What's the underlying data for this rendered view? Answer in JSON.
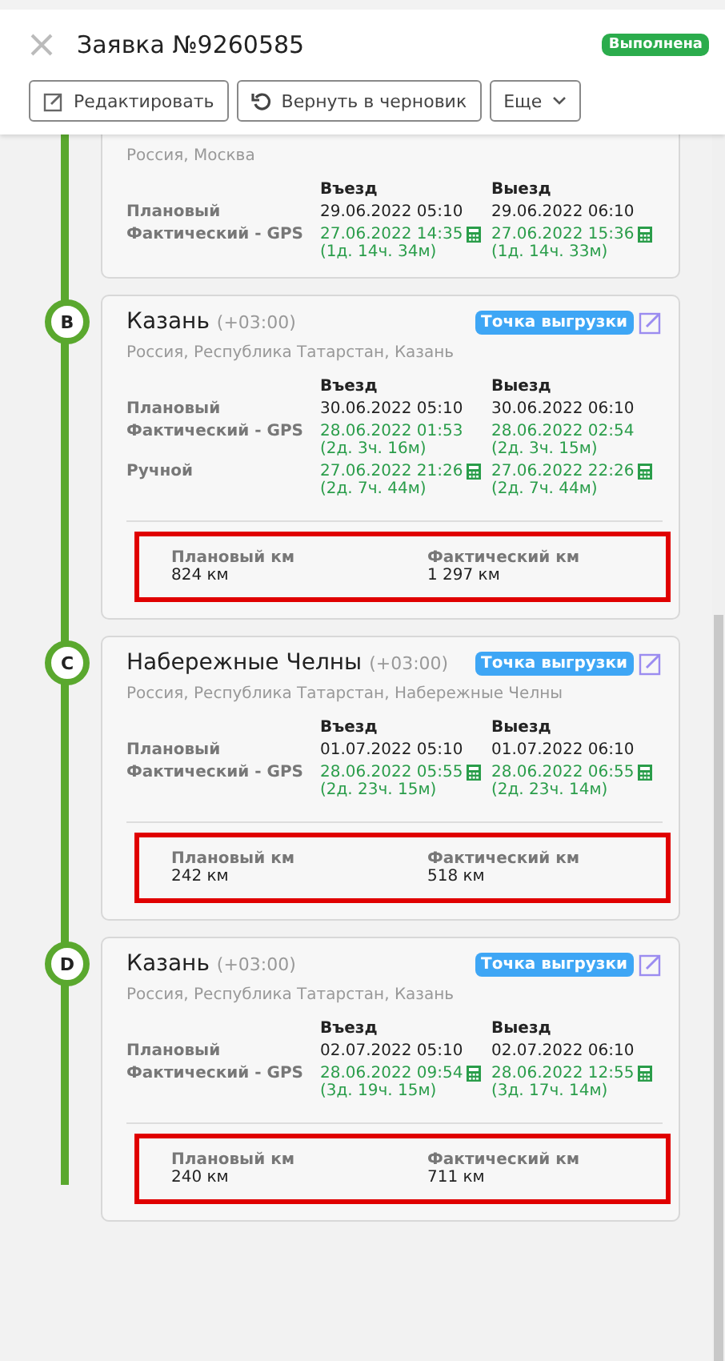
{
  "header": {
    "title": "Заявка №9260585",
    "status": "Выполнена",
    "buttons": [
      {
        "kind": "edit",
        "label": "Редактировать"
      },
      {
        "kind": "revert",
        "label": "Вернуть в черновик"
      },
      {
        "kind": "more",
        "label": "Еще"
      }
    ]
  },
  "stops": [
    {
      "address": "Россия, Москва",
      "col_in": "Въезд",
      "col_out": "Выезд",
      "rows": [
        {
          "kind": "plan",
          "label": "Плановый",
          "in": {
            "time": "29.06.2022 05:10"
          },
          "out": {
            "time": "29.06.2022 06:10"
          }
        },
        {
          "kind": "actual",
          "label": "Фактический - GPS",
          "in": {
            "time": "27.06.2022 14:35",
            "delta": "(1д. 14ч. 34м)",
            "calc": true
          },
          "out": {
            "time": "27.06.2022 15:36",
            "delta": "(1д. 14ч. 33м)",
            "calc": true
          }
        }
      ]
    },
    {
      "letter": "B",
      "city": "Казань",
      "tz": "(+03:00)",
      "badge": "Точка выгрузки",
      "address": "Россия, Республика Татарстан, Казань",
      "col_in": "Въезд",
      "col_out": "Выезд",
      "rows": [
        {
          "kind": "plan",
          "label": "Плановый",
          "in": {
            "time": "30.06.2022 05:10"
          },
          "out": {
            "time": "30.06.2022 06:10"
          }
        },
        {
          "kind": "actual",
          "label": "Фактический - GPS",
          "in": {
            "time": "28.06.2022 01:53",
            "delta": "(2д. 3ч. 16м)",
            "calc": false
          },
          "out": {
            "time": "28.06.2022 02:54",
            "delta": "(2д. 3ч. 15м)",
            "calc": false
          }
        },
        {
          "kind": "actual",
          "label": "Ручной",
          "in": {
            "time": "27.06.2022 21:26",
            "delta": "(2д. 7ч. 44м)",
            "calc": true
          },
          "out": {
            "time": "27.06.2022 22:26",
            "delta": "(2д. 7ч. 44м)",
            "calc": true
          }
        }
      ],
      "km": {
        "highlighted": true,
        "plan_label": "Плановый км",
        "plan": "824 км",
        "fact_label": "Фактический км",
        "fact": "1 297 км"
      }
    },
    {
      "letter": "C",
      "city": "Набережные Челны",
      "tz": "(+03:00)",
      "badge": "Точка выгрузки",
      "address": "Россия, Республика Татарстан, Набережные Челны",
      "col_in": "Въезд",
      "col_out": "Выезд",
      "rows": [
        {
          "kind": "plan",
          "label": "Плановый",
          "in": {
            "time": "01.07.2022 05:10"
          },
          "out": {
            "time": "01.07.2022 06:10"
          }
        },
        {
          "kind": "actual",
          "label": "Фактический - GPS",
          "in": {
            "time": "28.06.2022 05:55",
            "delta": "(2д. 23ч. 15м)",
            "calc": true
          },
          "out": {
            "time": "28.06.2022 06:55",
            "delta": "(2д. 23ч. 14м)",
            "calc": true
          }
        }
      ],
      "km": {
        "highlighted": true,
        "plan_label": "Плановый км",
        "plan": "242 км",
        "fact_label": "Фактический км",
        "fact": "518 км"
      }
    },
    {
      "letter": "D",
      "city": "Казань",
      "tz": "(+03:00)",
      "badge": "Точка выгрузки",
      "address": "Россия, Республика Татарстан, Казань",
      "col_in": "Въезд",
      "col_out": "Выезд",
      "rows": [
        {
          "kind": "plan",
          "label": "Плановый",
          "in": {
            "time": "02.07.2022 05:10"
          },
          "out": {
            "time": "02.07.2022 06:10"
          }
        },
        {
          "kind": "actual",
          "label": "Фактический - GPS",
          "in": {
            "time": "28.06.2022 09:54",
            "delta": "(3д. 19ч. 15м)",
            "calc": true
          },
          "out": {
            "time": "28.06.2022 12:55",
            "delta": "(3д. 17ч. 14м)",
            "calc": true
          }
        }
      ],
      "km": {
        "highlighted": true,
        "plan_label": "Плановый км",
        "plan": "240 км",
        "fact_label": "Фактический км",
        "fact": "711 км"
      }
    }
  ]
}
